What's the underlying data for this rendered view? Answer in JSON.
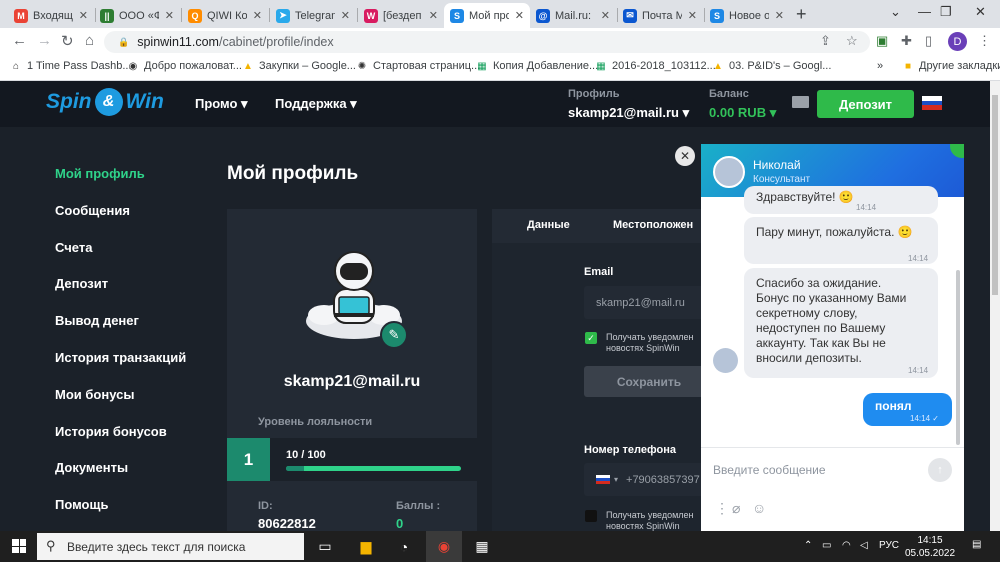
{
  "browser": {
    "tabs": [
      {
        "label": "Входящ",
        "color": "#ea4335",
        "glyph": "M",
        "name": "gmail-icon"
      },
      {
        "label": "ООО «Ф",
        "color": "#2e7d32",
        "glyph": "||",
        "name": "company-icon"
      },
      {
        "label": "QIWI Ко",
        "color": "#ff8c00",
        "glyph": "Q",
        "name": "qiwi-icon"
      },
      {
        "label": "Telegram",
        "color": "#29a9eb",
        "glyph": "➤",
        "name": "telegram-icon"
      },
      {
        "label": "[бездеп",
        "color": "#d81b60",
        "glyph": "W",
        "name": "site-w-icon"
      },
      {
        "label": "Мой про",
        "color": "#1e88e5",
        "glyph": "S",
        "name": "spinwin-icon"
      },
      {
        "label": "Mail.ru: ",
        "color": "#0b57d0",
        "glyph": "@",
        "name": "mailru-icon"
      },
      {
        "label": "Почта М",
        "color": "#0b57d0",
        "glyph": "✉",
        "name": "mail-envelope-icon"
      },
      {
        "label": "Новое о",
        "color": "#1e88e5",
        "glyph": "S",
        "name": "spinwin-icon"
      }
    ],
    "new_tab": "+",
    "url_host": "spinwin11.com",
    "url_path": "/cabinet/profile/index",
    "profile_initial": "D",
    "bookmarks": [
      {
        "label": "1 Time Pass Dashb...",
        "glyph": "⌂",
        "name": "bookmark-icon"
      },
      {
        "label": "Добро пожаловат...",
        "glyph": "◉",
        "name": "github-icon"
      },
      {
        "label": "Закупки – Google...",
        "glyph": "▲",
        "name": "drive-icon"
      },
      {
        "label": "Стартовая страниц...",
        "glyph": "✺",
        "name": "site-icon"
      },
      {
        "label": "Копия Добавление...",
        "glyph": "▦",
        "name": "sheets-icon"
      },
      {
        "label": "2016-2018_103112...",
        "glyph": "▦",
        "name": "sheets-icon"
      },
      {
        "label": "03. P&ID's – Googl...",
        "glyph": "▲",
        "name": "drive-icon"
      }
    ],
    "bookmarks_more": "»",
    "other_bookmarks": "Другие закладки"
  },
  "site": {
    "logo_left": "Spin",
    "logo_right": "Win",
    "nav": [
      "Промо ▾",
      "Поддержка ▾"
    ],
    "profile_label": "Профиль",
    "profile_value": "skamp21@mail.ru ▾",
    "balance_label": "Баланс",
    "balance_value": "0.00 RUB ▾",
    "deposit_button": "Депозит",
    "flag_colors": [
      "#ffffff",
      "#1c4fc4",
      "#d52b1e"
    ]
  },
  "sidebar": [
    "Мой профиль",
    "Сообщения",
    "Счета",
    "Депозит",
    "Вывод денег",
    "История транзакций",
    "Мои бонусы",
    "История бонусов",
    "Документы",
    "Помощь"
  ],
  "profile": {
    "title": "Мой профиль",
    "email": "skamp21@mail.ru",
    "loyalty_label": "Уровень лояльности",
    "level": "1",
    "progress_text": "10 / 100",
    "progress": 0.1,
    "id_label": "ID:",
    "id_value": "80622812",
    "points_label": "Баллы :",
    "points_value": "0"
  },
  "form": {
    "tab_data": "Данные",
    "tab_location": "Местоположен",
    "email_label": "Email",
    "email_placeholder": "skamp21@mail.ru",
    "notify_text_1": "Получать уведомлен",
    "notify_text_2": "новостях SpinWin",
    "save_button": "Сохранить",
    "phone_label": "Номер телефона",
    "phone_value": "+79063857397"
  },
  "chat": {
    "agent_name": "Николай",
    "agent_role": "Консультант",
    "messages": [
      {
        "text": "Здравствуйте! 🙂",
        "time": "14:14"
      },
      {
        "text": "Пару минут, пожалуйста. 🙂",
        "time": "14:14"
      },
      {
        "text": "Спасибо за ожидание. Бонус по указанному Вами секретному слову, недоступен по Вашему аккаунту. Так как Вы не вносили депозиты.",
        "time": "14:14"
      }
    ],
    "my_message": "понял",
    "my_time": "14:14 ✓",
    "input_placeholder": "Введите сообщение"
  },
  "taskbar": {
    "search_placeholder": "Введите здесь текст для поиска",
    "lang": "РУС",
    "time": "14:15",
    "date": "05.05.2022"
  }
}
